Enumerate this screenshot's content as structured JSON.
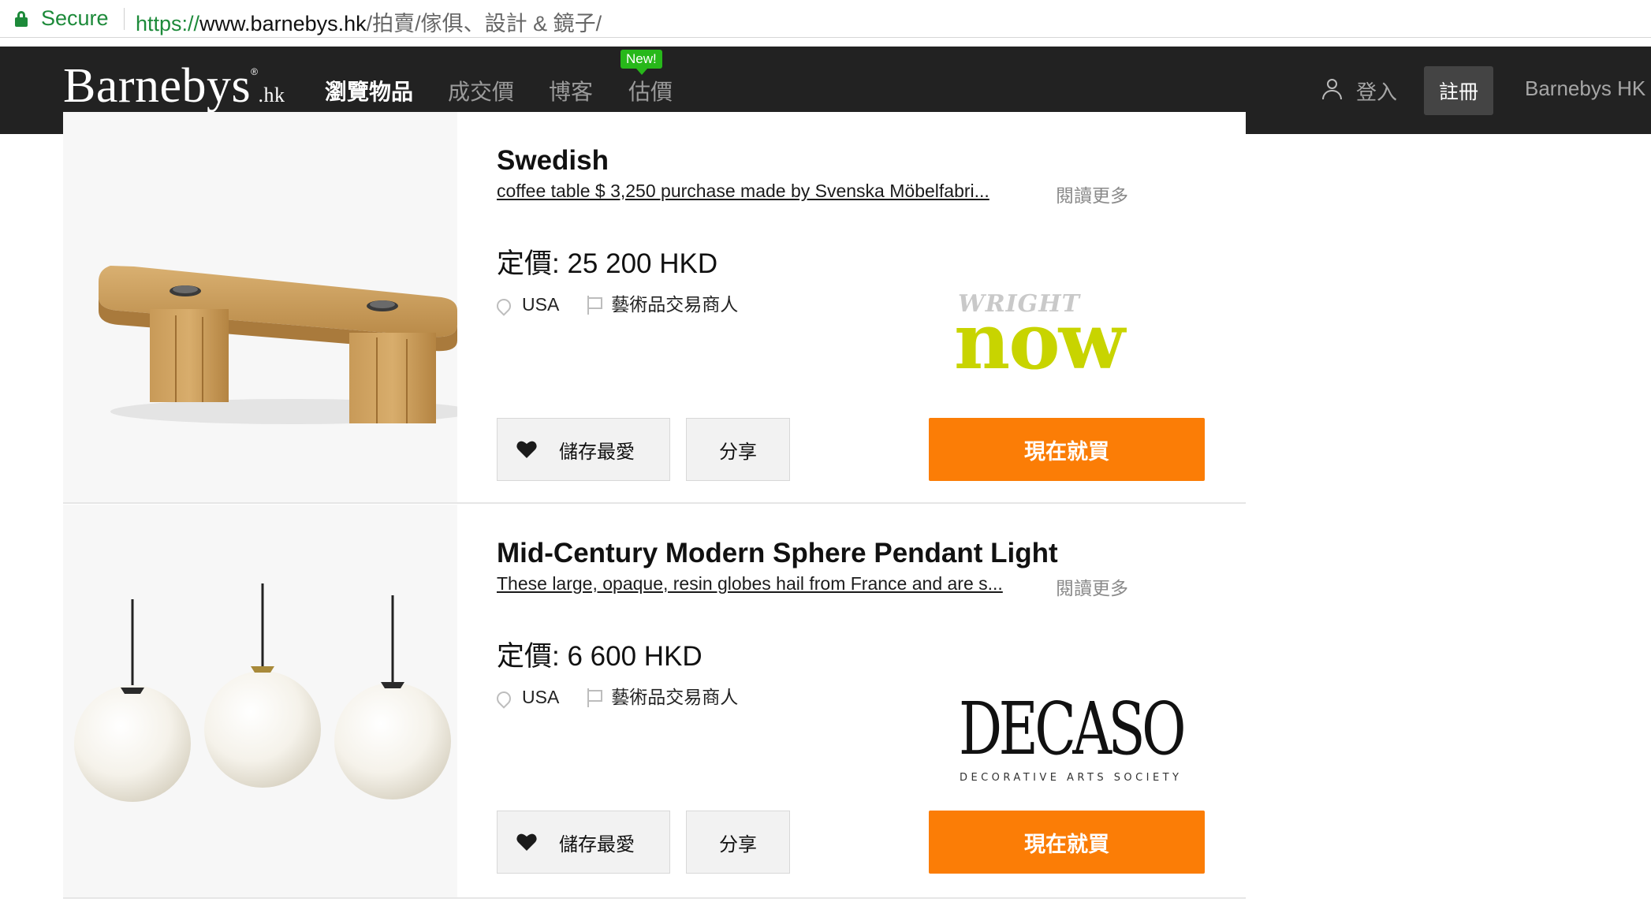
{
  "browser": {
    "secure_label": "Secure",
    "url_protocol": "https://",
    "url_host": "www.barnebys.hk",
    "url_path": "/拍賣/傢俱、設計 & 鏡子/"
  },
  "nav": {
    "logo_text": "Barnebys",
    "logo_reg": "®",
    "logo_tld": ".hk",
    "items": [
      {
        "label": "瀏覽物品",
        "active": true
      },
      {
        "label": "成交價"
      },
      {
        "label": "博客"
      },
      {
        "label": "估價"
      }
    ],
    "new_badge": "New!",
    "login": "登入",
    "register": "註冊",
    "site_name": "Barnebys HK"
  },
  "listings": [
    {
      "title": "Swedish",
      "description": "coffee table $ 3,250   purchase made by Svenska Möbelfabri...",
      "read_more": "閱讀更多",
      "price": "定價: 25 200 HKD",
      "location": "USA",
      "seller_type": "藝術品交易商人",
      "save_label": "儲存最愛",
      "share_label": "分享",
      "buy_label": "現在就買",
      "dealer_logo_top": "WRIGHT",
      "dealer_logo_main": "now"
    },
    {
      "title": "Mid-Century Modern Sphere Pendant Light",
      "description": "These large, opaque, resin globes hail from France and are s...",
      "read_more": "閱讀更多",
      "price": "定價: 6 600 HKD",
      "location": "USA",
      "seller_type": "藝術品交易商人",
      "save_label": "儲存最愛",
      "share_label": "分享",
      "buy_label": "現在就買",
      "dealer_logo_main": "DECASO",
      "dealer_logo_sub": "DECORATIVE ARTS SOCIETY"
    }
  ],
  "colors": {
    "accent": "#fb7d06",
    "nav_bg": "#222222",
    "secure_green": "#1d8a3a",
    "new_badge": "#27b81a",
    "wright_now": "#c8d400"
  }
}
